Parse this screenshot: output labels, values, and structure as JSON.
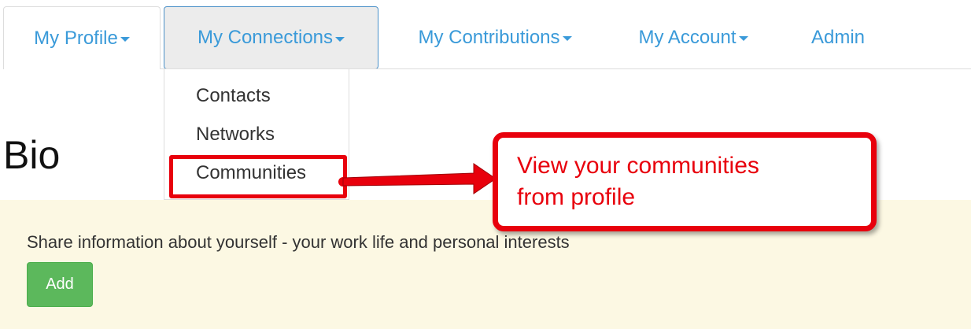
{
  "nav": {
    "tabs": [
      {
        "label": "My Profile",
        "has_caret": true
      },
      {
        "label": "My Connections",
        "has_caret": true,
        "active": true
      },
      {
        "label": "My Contributions",
        "has_caret": true
      },
      {
        "label": "My Account",
        "has_caret": true
      },
      {
        "label": "Admin",
        "has_caret": false
      }
    ]
  },
  "dropdown": {
    "items": [
      {
        "label": "Contacts"
      },
      {
        "label": "Networks"
      },
      {
        "label": "Communities",
        "highlighted": true
      }
    ]
  },
  "bio": {
    "title": "Bio",
    "description": "Share information about yourself - your work life and personal interests",
    "add_label": "Add"
  },
  "callout": {
    "line1": "View your communities",
    "line2": "from profile"
  },
  "colors": {
    "link": "#3a9ad9",
    "annotation": "#e8000c",
    "panel_bg": "#fcf8e3",
    "add_button": "#5cb85c"
  }
}
